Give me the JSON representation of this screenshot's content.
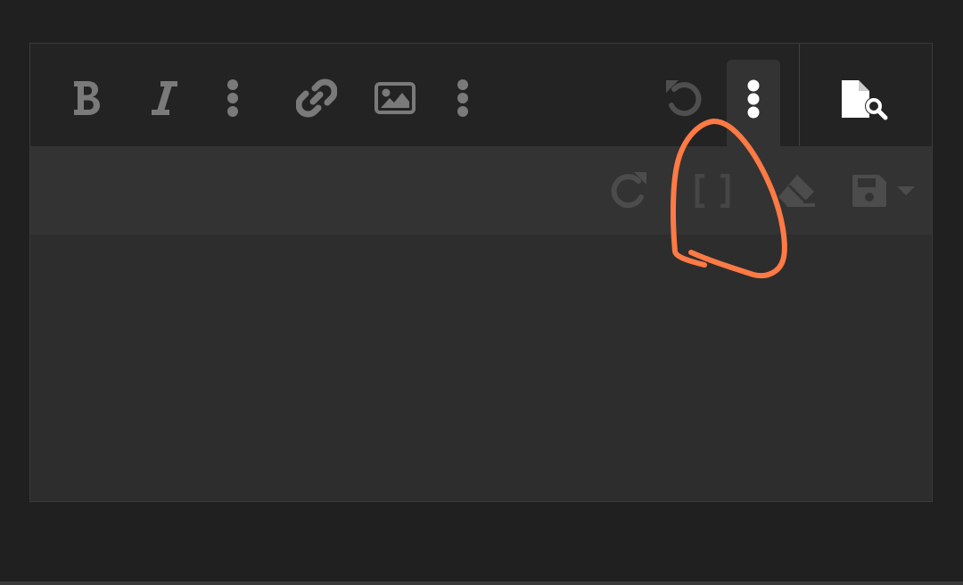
{
  "toolbar": {
    "primary": [
      {
        "name": "bold-button",
        "icon": "bold-icon"
      },
      {
        "name": "italic-button",
        "icon": "italic-icon"
      },
      {
        "name": "more-text-button",
        "icon": "vertical-ellipsis-icon"
      },
      {
        "name": "link-button",
        "icon": "link-icon"
      },
      {
        "name": "image-button",
        "icon": "image-icon"
      },
      {
        "name": "more-insert-button",
        "icon": "vertical-ellipsis-icon"
      },
      {
        "name": "undo-button",
        "icon": "undo-icon"
      },
      {
        "name": "more-misc-button",
        "icon": "vertical-ellipsis-icon",
        "state": "active"
      },
      {
        "name": "preview-button",
        "icon": "file-search-icon"
      }
    ],
    "secondary": [
      {
        "name": "redo-button",
        "icon": "redo-icon"
      },
      {
        "name": "bbcode-toggle-button",
        "icon": "brackets-icon",
        "state": "disabled"
      },
      {
        "name": "remove-format-button",
        "icon": "eraser-icon"
      },
      {
        "name": "save-draft-button",
        "icon": "floppy-disk-icon"
      },
      {
        "name": "save-draft-dropdown",
        "icon": "caret-down-icon"
      }
    ]
  },
  "editor": {
    "content": ""
  },
  "colors": {
    "page_background": "#202020",
    "toolbar_primary": "#232323",
    "toolbar_secondary": "#333333",
    "editor_body": "#2d2d2d",
    "icon_default": "#7a7a7a",
    "icon_bright": "#ffffff",
    "icon_disabled": "#4c4c4c",
    "annotation_stroke": "#ff7a45"
  }
}
